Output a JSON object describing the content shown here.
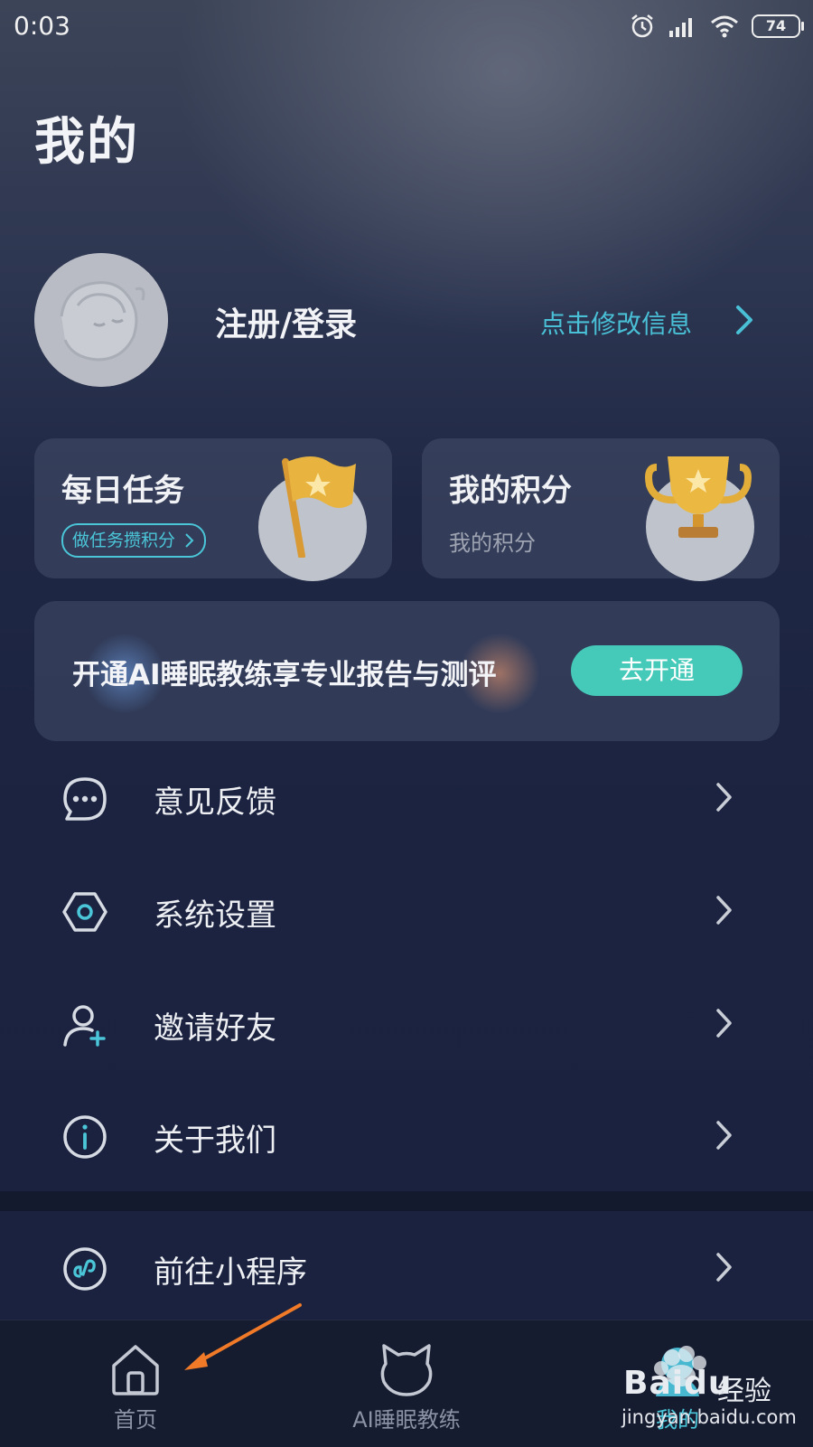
{
  "status_bar": {
    "time": "0:03",
    "battery": "74"
  },
  "page": {
    "title": "我的"
  },
  "profile": {
    "login_label": "注册/登录",
    "edit_label": "点击修改信息"
  },
  "cards": {
    "daily_task": {
      "title": "每日任务",
      "pill_label": "做任务攒积分"
    },
    "points": {
      "title": "我的积分",
      "subtitle": "我的积分"
    }
  },
  "promo": {
    "text": "开通AI睡眠教练享专业报告与测评",
    "button_label": "去开通"
  },
  "menu": {
    "items": [
      {
        "label": "意见反馈",
        "icon": "chat-bubble-icon"
      },
      {
        "label": "系统设置",
        "icon": "hexagon-settings-icon"
      },
      {
        "label": "邀请好友",
        "icon": "add-user-icon"
      },
      {
        "label": "关于我们",
        "icon": "info-icon"
      },
      {
        "label": "前往小程序",
        "icon": "mini-program-icon"
      }
    ]
  },
  "tabbar": {
    "tabs": [
      {
        "label": "首页",
        "icon": "home-icon"
      },
      {
        "label": "AI睡眠教练",
        "icon": "cat-face-icon"
      },
      {
        "label": "我的",
        "icon": "profile-icon"
      }
    ]
  },
  "watermark": {
    "brand": "Baidu",
    "suffix": "经验",
    "url": "jingyan.baidu.com"
  },
  "colors": {
    "accent": "#49c0d6",
    "button": "#45c9b8",
    "background": "#1b2340"
  }
}
